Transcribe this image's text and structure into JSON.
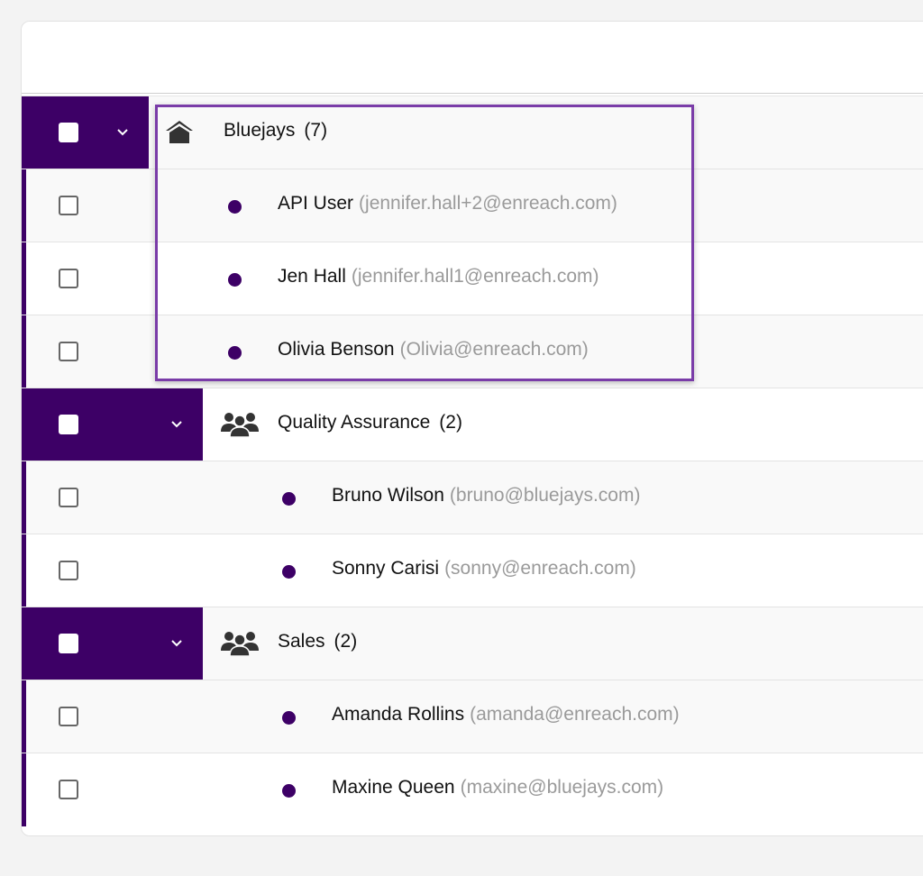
{
  "colors": {
    "accent": "#3d0066",
    "highlight": "#7a3ca8",
    "email": "#9a9a9a"
  },
  "groups": [
    {
      "name": "Bluejays",
      "count": "(7)",
      "icon": "home-icon",
      "users": [
        {
          "name": "API User",
          "email": "(jennifer.hall+2@enreach.com)"
        },
        {
          "name": "Jen Hall",
          "email": "(jennifer.hall1@enreach.com)"
        },
        {
          "name": "Olivia Benson",
          "email": "(Olivia@enreach.com)"
        }
      ]
    },
    {
      "name": "Quality Assurance",
      "count": "(2)",
      "icon": "group-icon",
      "users": [
        {
          "name": "Bruno Wilson",
          "email": "(bruno@bluejays.com)"
        },
        {
          "name": "Sonny Carisi",
          "email": "(sonny@enreach.com)"
        }
      ]
    },
    {
      "name": "Sales",
      "count": "(2)",
      "icon": "group-icon",
      "users": [
        {
          "name": "Amanda Rollins",
          "email": "(amanda@enreach.com)"
        },
        {
          "name": "Maxine Queen",
          "email": "(maxine@bluejays.com)"
        }
      ]
    }
  ]
}
